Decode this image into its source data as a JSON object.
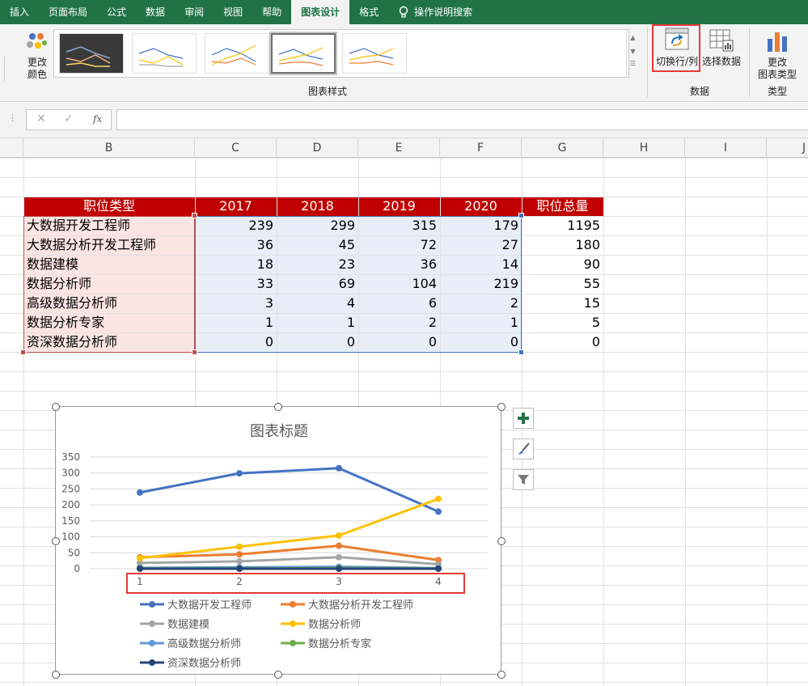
{
  "ribbon_tabs": [
    "插入",
    "页面布局",
    "公式",
    "数据",
    "审阅",
    "视图",
    "帮助",
    "图表设计",
    "格式"
  ],
  "search_tab": "操作说明搜索",
  "ribbon": {
    "change_colors_line1": "更改",
    "change_colors_line2": "颜色",
    "chart_styles_group": "图表样式",
    "switch_row_col": "切换行/列",
    "select_data": "选择数据",
    "data_group": "数据",
    "change_type_line1": "更改",
    "change_type_line2": "图表类型",
    "type_group": "类型"
  },
  "formula_bar": {
    "fx": "fx",
    "value": ""
  },
  "columns": [
    "B",
    "C",
    "D",
    "E",
    "F",
    "G",
    "H",
    "I",
    "J"
  ],
  "table": {
    "headers": [
      "职位类型",
      "2017",
      "2018",
      "2019",
      "2020",
      "职位总量"
    ],
    "rows": [
      [
        "大数据开发工程师",
        "239",
        "299",
        "315",
        "179",
        "1195"
      ],
      [
        "大数据分析开发工程师",
        "36",
        "45",
        "72",
        "27",
        "180"
      ],
      [
        "数据建模",
        "18",
        "23",
        "36",
        "14",
        "90"
      ],
      [
        "数据分析师",
        "33",
        "69",
        "104",
        "219",
        "55"
      ],
      [
        "高级数据分析师",
        "3",
        "4",
        "6",
        "2",
        "15"
      ],
      [
        "数据分析专家",
        "1",
        "1",
        "2",
        "1",
        "5"
      ],
      [
        "资深数据分析师",
        "0",
        "0",
        "0",
        "0",
        "0"
      ]
    ]
  },
  "colors": {
    "ribbon_green": "#217346",
    "header_red": "#c00000",
    "category_fill": "#fbe5e3",
    "value_fill": "#e8eef8",
    "highlight": "#e53935"
  },
  "chart_data": {
    "type": "line",
    "title": "图表标题",
    "categories": [
      "1",
      "2",
      "3",
      "4"
    ],
    "ylim": [
      0,
      350
    ],
    "yticks": [
      "0",
      "50",
      "100",
      "150",
      "200",
      "250",
      "300",
      "350"
    ],
    "grid": true,
    "legend_position": "bottom",
    "series": [
      {
        "name": "大数据开发工程师",
        "values": [
          239,
          299,
          315,
          179
        ],
        "color": "#4472c4"
      },
      {
        "name": "大数据分析开发工程师",
        "values": [
          36,
          45,
          72,
          27
        ],
        "color": "#ed7d31"
      },
      {
        "name": "数据建模",
        "values": [
          18,
          23,
          36,
          14
        ],
        "color": "#a5a5a5"
      },
      {
        "name": "数据分析师",
        "values": [
          33,
          69,
          104,
          219
        ],
        "color": "#ffc000"
      },
      {
        "name": "高级数据分析师",
        "values": [
          3,
          4,
          6,
          2
        ],
        "color": "#5b9bd5"
      },
      {
        "name": "数据分析专家",
        "values": [
          1,
          1,
          2,
          1
        ],
        "color": "#70ad47"
      },
      {
        "name": "资深数据分析师",
        "values": [
          0,
          0,
          0,
          0
        ],
        "color": "#264478"
      }
    ]
  }
}
